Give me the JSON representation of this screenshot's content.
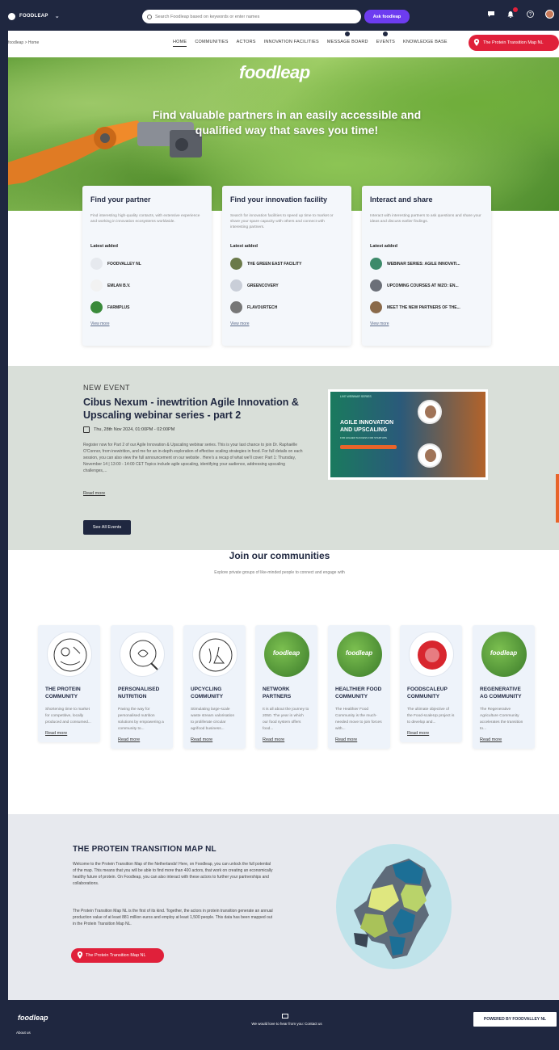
{
  "topbar": {
    "brand": "FOODLEAP",
    "search_placeholder": "Search Foodleap based on keywords or enter names",
    "ask_button": "Ask foodleap",
    "icons": [
      "chat-icon",
      "bell-icon",
      "help-icon",
      "avatar"
    ]
  },
  "nav": {
    "breadcrumb": "foodleap > Home",
    "items": [
      "HOME",
      "COMMUNITIES",
      "ACTORS",
      "INNOVATION FACILITIES",
      "MESSAGE BOARD",
      "EVENTS",
      "KNOWLEDGE BASE"
    ],
    "active": "HOME",
    "cta": "The Protein Transition Map NL"
  },
  "hero": {
    "logo": "foodleap",
    "headline": "Find valuable partners in an easily accessible and qualified way that saves you time!"
  },
  "cards": [
    {
      "title": "Find your partner",
      "desc": "Find interesting high-quality contacts, with extensive experience and working in innovation ecosystems worldwide.",
      "latest_label": "Latest added",
      "items": [
        "FOODVALLEY NL",
        "EMLAN B.V.",
        "FARMPLUS"
      ],
      "view_more": "View more"
    },
    {
      "title": "Find your innovation facility",
      "desc": "Search for innovation facilities to speed up time to market or share your spare capacity with others and connect with interesting partners.",
      "latest_label": "Latest added",
      "items": [
        "THE GREEN EAST FACILITY",
        "GREENCOVERY",
        "FLAVOURTECH"
      ],
      "view_more": "View more"
    },
    {
      "title": "Interact and share",
      "desc": "Interact with interesting partners to ask questions and share your ideas and discuss earlier findings.",
      "latest_label": "Latest added",
      "items": [
        "WEBINAR SERIES: AGILE INNOVATI...",
        "UPCOMING COURSES AT NIZO: EN...",
        "MEET THE NEW PARTNERS OF THE..."
      ],
      "view_more": "View more"
    }
  ],
  "event": {
    "kicker": "NEW EVENT",
    "title": "Cibus Nexum - inewtrition Agile Innovation & Upscaling webinar series - part 2",
    "date": "Thu, 28th Nov 2024, 01:00PM - 02:00PM",
    "desc": "Register now for Part 2 of our Agile Innovation & Upscaling webinar series. This is your last chance to join Dr. Raphaëlle O'Connor, from inewtrition, and me for an in-depth exploration of effective scaling strategies in food. For full details on each session, you can also view the full announcement on our website . Here's a recap of what we'll cover: Part 1: Thursday, November 14 | 13:00 - 14:00 CET Topics include agile upscaling, identifying your audience, addressing upscaling challenges,...",
    "read_more": "Read more",
    "button": "See All Events",
    "image": {
      "kicker": "LIVE WEBINAR SERIES",
      "title_line1": "AGILE INNOVATION",
      "title_line2": "AND UPSCALING",
      "sub": "FOR HIGHER SUCCESS FOR STARTUPS"
    }
  },
  "communities": {
    "title": "Join our communities",
    "subtitle": "Explore private groups of like-minded people to connect and engage with",
    "read_more": "Read more",
    "items": [
      {
        "name": "THE PROTEIN COMMUNITY",
        "desc": "Shortening time to market for competitive, locally produced and consumed..."
      },
      {
        "name": "PERSONALISED NUTRITION",
        "desc": "Paving the way for personalised nutrition solutions by empowering a community to..."
      },
      {
        "name": "UPCYCLING COMMUNITY",
        "desc": "Stimulating large-scale waste stream valorisation to proliferate circular agrifood business..."
      },
      {
        "name": "NETWORK PARTNERS",
        "desc": "It is all about the journey to 2050. The year in which our food system offers food..."
      },
      {
        "name": "HEALTHIER FOOD COMMUNITY",
        "desc": "The Healthier Food Community is the much-needed move to join forces with..."
      },
      {
        "name": "FOODSCALEUP COMMUNITY",
        "desc": "The ultimate objective of the Food-scaleUp project is to develop and..."
      },
      {
        "name": "REGENERATIVE AG COMMUNITY",
        "desc": "The Regenerative Agriculture Community accelerates the transition to..."
      }
    ]
  },
  "map": {
    "title": "THE PROTEIN TRANSITION MAP NL",
    "p1": "Welcome to the Protein Transition Map of the Netherlands! Here, on Foodleap, you can unlock the full potential of the map. This means that you will be able to find more than 400 actors, that work on creating an economically healthy future of protein. On Foodleap, you can also interact with these actors to further your partnerships and collaborations.",
    "p2": "The Protein Transition Map NL is the first of its kind. Together, the actors in protein transition generate an annual production value of at least 881 million euros and employ at least 1,500 people. This data has been mapped out in the Protein Transition Map NL.",
    "button": "The Protein Transition Map NL"
  },
  "footer": {
    "logo": "foodleap",
    "about": "About us",
    "contact": "We would love to hear from you: Contact us",
    "powered": "POWERED BY FOODVALLEY NL"
  },
  "colors": {
    "navy": "#1f2740",
    "red": "#e0203a",
    "purple": "#6d3cf0",
    "grey_band": "#d9dfd9"
  }
}
